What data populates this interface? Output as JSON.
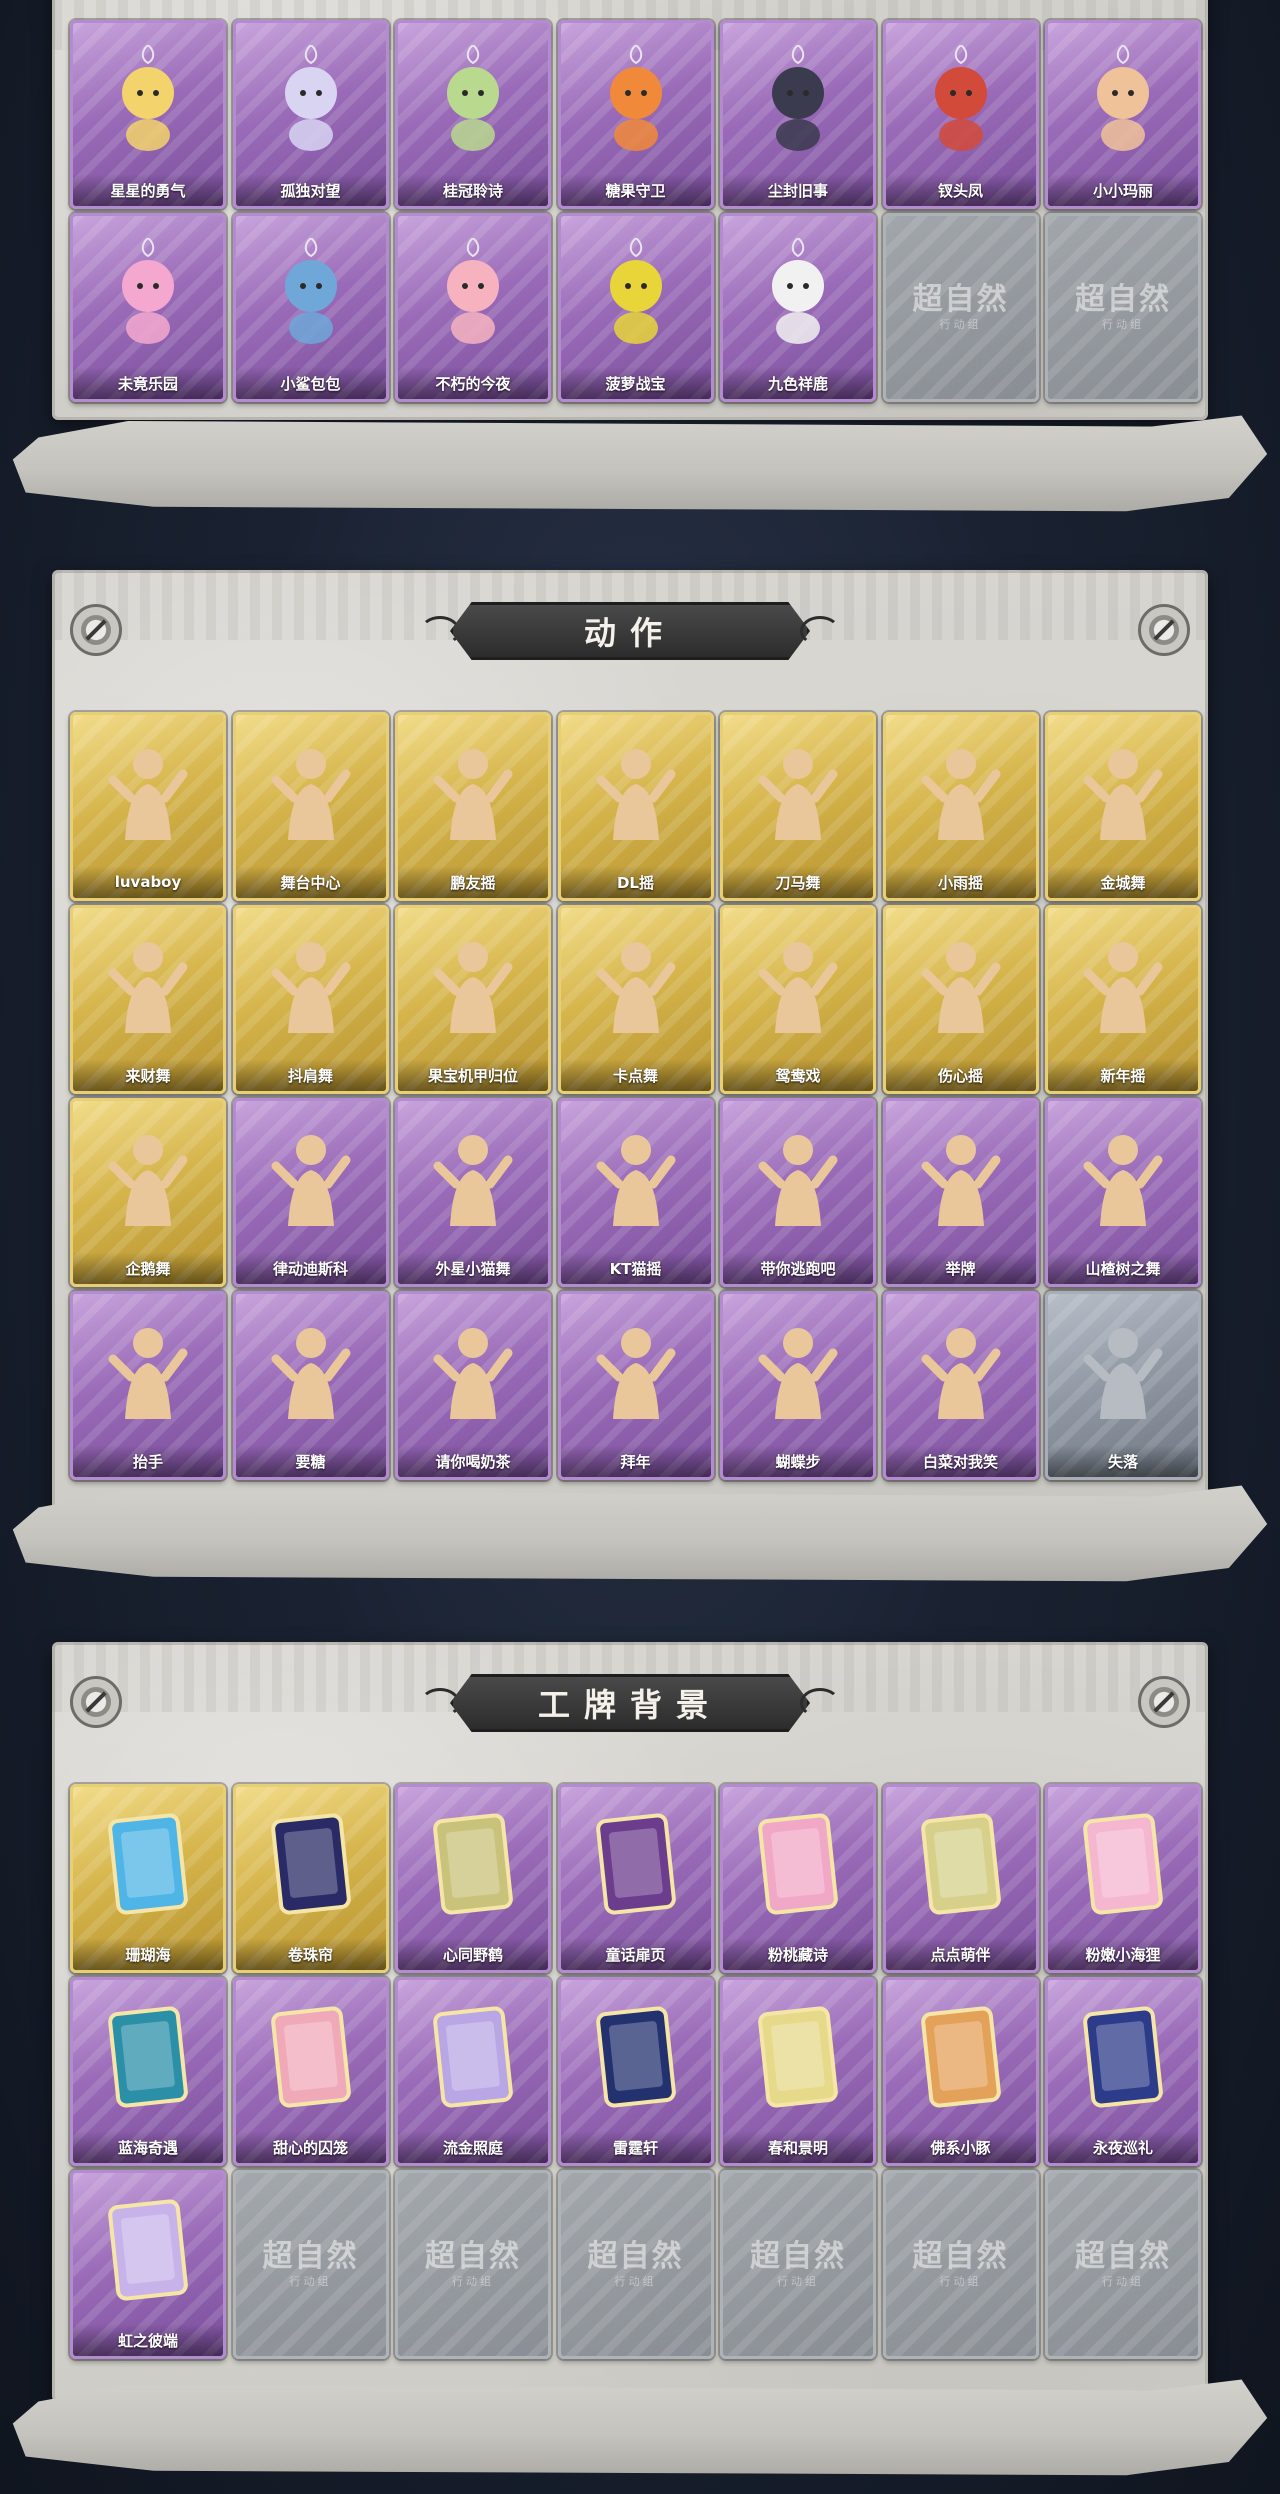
{
  "sections": [
    {
      "title": "",
      "items": [
        {
          "label": "星星的勇气",
          "rarity": "purple",
          "icon": "planet-charm-icon"
        },
        {
          "label": "孤独对望",
          "rarity": "purple",
          "icon": "white-hair-charm-icon"
        },
        {
          "label": "桂冠聆诗",
          "rarity": "purple",
          "icon": "laurel-charm-icon"
        },
        {
          "label": "糖果守卫",
          "rarity": "purple",
          "icon": "pumpkin-charm-icon"
        },
        {
          "label": "尘封旧事",
          "rarity": "purple",
          "icon": "dark-prince-charm-icon"
        },
        {
          "label": "钗头凤",
          "rarity": "purple",
          "icon": "phoenix-crown-icon"
        },
        {
          "label": "小小玛丽",
          "rarity": "purple",
          "icon": "doll-charm-icon"
        },
        {
          "label": "未竟乐园",
          "rarity": "purple",
          "icon": "pink-star-charm-icon"
        },
        {
          "label": "小鲨包包",
          "rarity": "purple",
          "icon": "shark-bag-icon"
        },
        {
          "label": "不朽的今夜",
          "rarity": "purple",
          "icon": "cat-bowl-icon"
        },
        {
          "label": "菠萝战宝",
          "rarity": "purple",
          "icon": "pineapple-robot-icon"
        },
        {
          "label": "九色祥鹿",
          "rarity": "purple",
          "icon": "deer-charm-icon"
        },
        {
          "label": "",
          "rarity": "locked",
          "icon": "locked-slot-icon"
        },
        {
          "label": "",
          "rarity": "locked",
          "icon": "locked-slot-icon"
        }
      ]
    },
    {
      "title": "动作",
      "items": [
        {
          "label": "luvaboy",
          "rarity": "gold",
          "icon": "dance-pose-icon"
        },
        {
          "label": "舞台中心",
          "rarity": "gold",
          "icon": "dance-pose-icon"
        },
        {
          "label": "鹏友摇",
          "rarity": "gold",
          "icon": "dance-pose-icon"
        },
        {
          "label": "DL摇",
          "rarity": "gold",
          "icon": "dance-pose-icon"
        },
        {
          "label": "刀马舞",
          "rarity": "gold",
          "icon": "dance-pose-icon"
        },
        {
          "label": "小雨摇",
          "rarity": "gold",
          "icon": "dance-pose-icon"
        },
        {
          "label": "金城舞",
          "rarity": "gold",
          "icon": "dance-pose-icon"
        },
        {
          "label": "来财舞",
          "rarity": "gold",
          "icon": "dance-pose-icon"
        },
        {
          "label": "抖肩舞",
          "rarity": "gold",
          "icon": "dance-pose-icon"
        },
        {
          "label": "果宝机甲归位",
          "rarity": "gold",
          "icon": "dance-pose-icon"
        },
        {
          "label": "卡点舞",
          "rarity": "gold",
          "icon": "dance-pose-icon"
        },
        {
          "label": "鸳鸯戏",
          "rarity": "gold",
          "icon": "dance-pose-icon"
        },
        {
          "label": "伤心摇",
          "rarity": "gold",
          "icon": "heart-pose-icon"
        },
        {
          "label": "新年摇",
          "rarity": "gold",
          "icon": "dance-pose-icon"
        },
        {
          "label": "企鹅舞",
          "rarity": "gold",
          "icon": "dance-pose-icon"
        },
        {
          "label": "律动迪斯科",
          "rarity": "purple",
          "icon": "dance-pose-icon"
        },
        {
          "label": "外星小猫舞",
          "rarity": "purple",
          "icon": "dance-pose-icon"
        },
        {
          "label": "KT猫摇",
          "rarity": "purple",
          "icon": "dance-pose-icon"
        },
        {
          "label": "带你逃跑吧",
          "rarity": "purple",
          "icon": "dance-pose-icon"
        },
        {
          "label": "举牌",
          "rarity": "purple",
          "icon": "sign-pose-icon"
        },
        {
          "label": "山楂树之舞",
          "rarity": "purple",
          "icon": "dance-pose-icon"
        },
        {
          "label": "抬手",
          "rarity": "purple",
          "icon": "raise-hand-pose-icon"
        },
        {
          "label": "要糖",
          "rarity": "purple",
          "icon": "ask-candy-pose-icon"
        },
        {
          "label": "请你喝奶茶",
          "rarity": "purple",
          "icon": "milk-tea-pose-icon"
        },
        {
          "label": "拜年",
          "rarity": "purple",
          "icon": "bow-pose-icon"
        },
        {
          "label": "蝴蝶步",
          "rarity": "purple",
          "icon": "butterfly-step-pose-icon"
        },
        {
          "label": "白菜对我笑",
          "rarity": "purple",
          "icon": "cabbage-pose-icon"
        },
        {
          "label": "失落",
          "rarity": "gray",
          "icon": "crawl-pose-icon"
        }
      ]
    },
    {
      "title": "工牌背景",
      "items": [
        {
          "label": "珊瑚海",
          "rarity": "gold",
          "icon": "badge-frame-icon",
          "tint": "#4fb4e6"
        },
        {
          "label": "卷珠帘",
          "rarity": "gold",
          "icon": "badge-frame-icon",
          "tint": "#2a2a66"
        },
        {
          "label": "心同野鹤",
          "rarity": "purple",
          "icon": "badge-frame-icon",
          "tint": "#c9c27a"
        },
        {
          "label": "童话扉页",
          "rarity": "purple",
          "icon": "badge-frame-icon",
          "tint": "#6b3d8c"
        },
        {
          "label": "粉桃藏诗",
          "rarity": "purple",
          "icon": "badge-frame-icon",
          "tint": "#f1a7c6"
        },
        {
          "label": "点点萌伴",
          "rarity": "purple",
          "icon": "badge-frame-icon",
          "tint": "#d6d08a"
        },
        {
          "label": "粉嫩小海狸",
          "rarity": "purple",
          "icon": "badge-frame-icon",
          "tint": "#f5b6d0"
        },
        {
          "label": "蓝海奇遇",
          "rarity": "purple",
          "icon": "badge-frame-icon",
          "tint": "#2b8fa8"
        },
        {
          "label": "甜心的囚笼",
          "rarity": "purple",
          "icon": "badge-frame-icon",
          "tint": "#f0a9b8"
        },
        {
          "label": "流金照庭",
          "rarity": "purple",
          "icon": "badge-frame-icon",
          "tint": "#b9a6e4"
        },
        {
          "label": "雷霆轩",
          "rarity": "purple",
          "icon": "badge-frame-icon",
          "tint": "#23316e"
        },
        {
          "label": "春和景明",
          "rarity": "purple",
          "icon": "badge-frame-icon",
          "tint": "#e6d98a"
        },
        {
          "label": "佛系小豚",
          "rarity": "purple",
          "icon": "badge-frame-icon",
          "tint": "#e4a15a"
        },
        {
          "label": "永夜巡礼",
          "rarity": "purple",
          "icon": "badge-frame-icon",
          "tint": "#2c3b8a"
        },
        {
          "label": "虹之彼端",
          "rarity": "purple",
          "icon": "badge-frame-icon",
          "tint": "#c7b3ea"
        },
        {
          "label": "",
          "rarity": "locked",
          "icon": "locked-slot-icon"
        },
        {
          "label": "",
          "rarity": "locked",
          "icon": "locked-slot-icon"
        },
        {
          "label": "",
          "rarity": "locked",
          "icon": "locked-slot-icon"
        },
        {
          "label": "",
          "rarity": "locked",
          "icon": "locked-slot-icon"
        },
        {
          "label": "",
          "rarity": "locked",
          "icon": "locked-slot-icon"
        },
        {
          "label": "",
          "rarity": "locked",
          "icon": "locked-slot-icon"
        }
      ]
    }
  ],
  "locked_watermark": "超自然",
  "locked_sub": "行动组",
  "colors": {
    "purple": "#9a6bb8",
    "gold": "#d6b54c",
    "gray": "#8e96a2",
    "panel": "#d3d1cb"
  }
}
